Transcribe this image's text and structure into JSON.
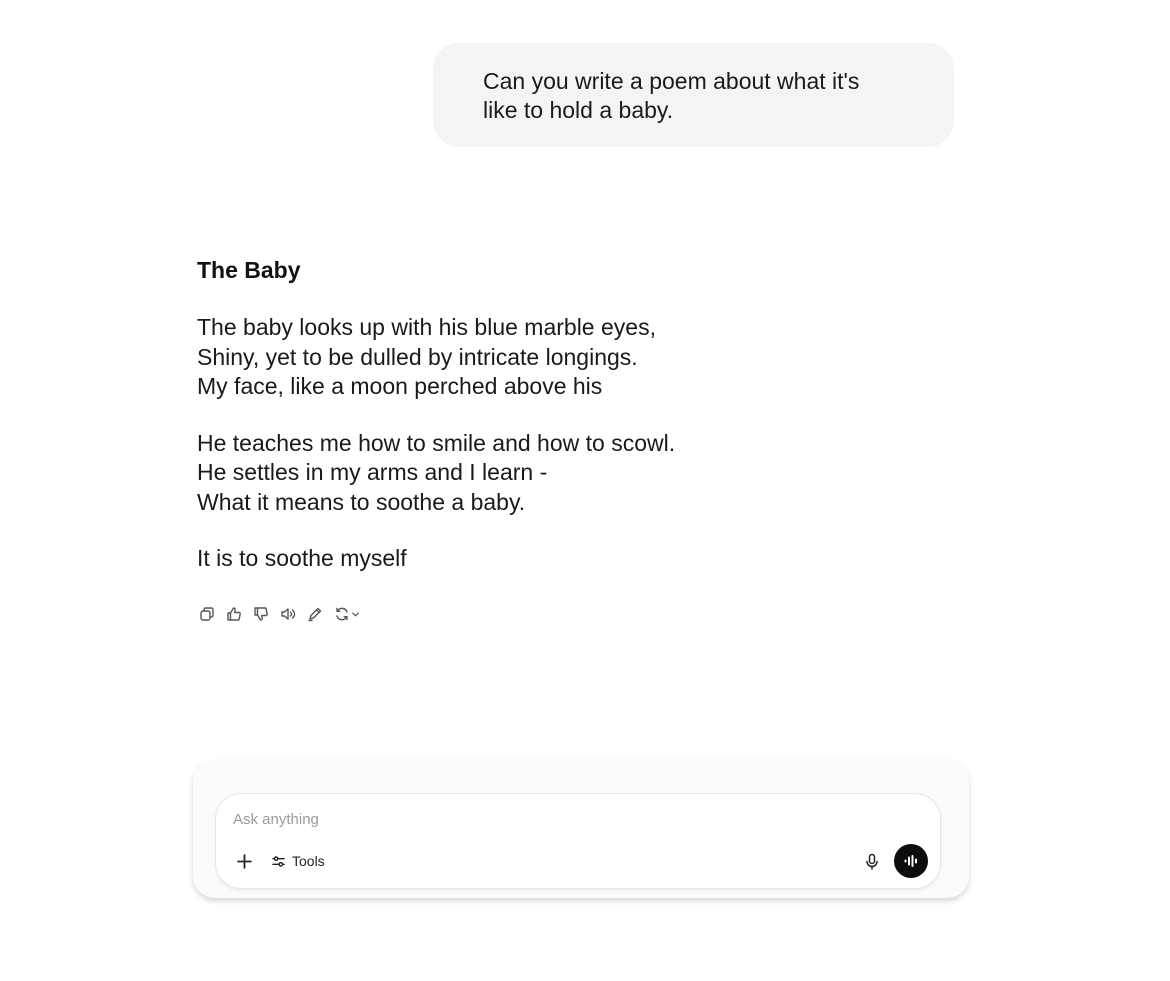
{
  "user_message": {
    "lines": [
      "Can you write a poem about what it's",
      "like to hold a baby."
    ]
  },
  "assistant_message": {
    "title": "The Baby",
    "stanzas": [
      [
        "The baby looks up with his blue marble eyes,",
        "Shiny, yet to be dulled by intricate longings.",
        "My face, like a moon perched above his"
      ],
      [
        "He teaches me how to smile and how to scowl.",
        "He settles in my arms and I learn -",
        "What it means to soothe a baby."
      ],
      [
        "It is to soothe myself"
      ]
    ]
  },
  "message_actions": [
    "copy-icon",
    "thumbs-up-icon",
    "thumbs-down-icon",
    "read-aloud-icon",
    "edit-icon",
    "regenerate-icon"
  ],
  "composer": {
    "placeholder": "Ask anything",
    "tools_label": "Tools"
  }
}
